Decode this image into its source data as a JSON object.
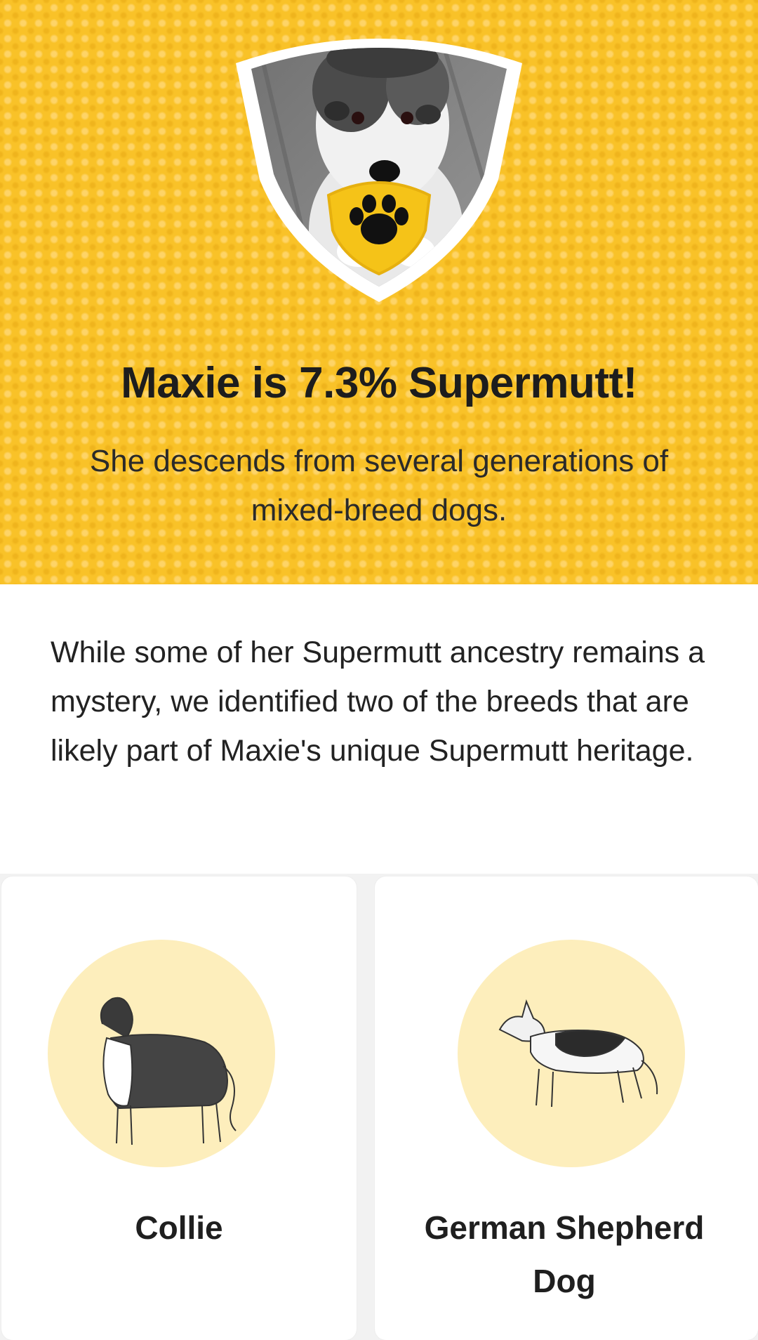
{
  "hero": {
    "title": "Maxie is 7.3% Supermutt!",
    "subtitle": "She descends from several generations of mixed-breed dogs.",
    "badge_icon": "paw-icon",
    "colors": {
      "background": "#f9c228",
      "badge_gold": "#f5c318",
      "shield_outline": "#ffffff"
    }
  },
  "intro": {
    "text": "While some of her Supermutt ancestry remains a mystery, we identified two of the breeds that are likely part of Maxie's unique Supermutt heritage."
  },
  "breeds": [
    {
      "name": "Collie",
      "icon": "collie-illustration"
    },
    {
      "name": "German Shepherd Dog",
      "icon": "german-shepherd-illustration"
    }
  ]
}
